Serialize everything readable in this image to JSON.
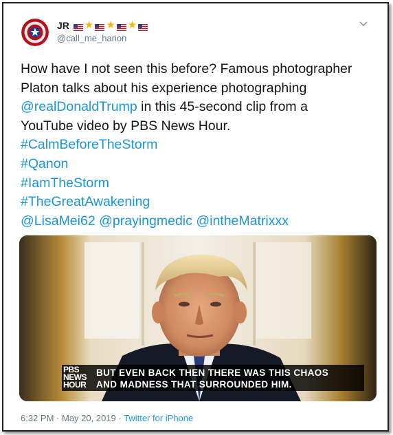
{
  "user": {
    "display_name": "JR",
    "handle": "@call_me_hanon",
    "name_emoji": [
      "us-flag-icon",
      "star-icon",
      "us-flag-icon",
      "star-icon",
      "us-flag-icon",
      "star-icon",
      "us-flag-icon"
    ],
    "avatar_icon": "captain-america-shield-icon"
  },
  "tweet": {
    "line1": "How have I not seen this before? Famous photographer",
    "line2": "Platon talks about his experience photographing",
    "mention_trump": "@realDonaldTrump",
    "line3_rest": " in this 45-second clip from a",
    "line4": "YouTube video by PBS News Hour.",
    "hashtags": [
      "#CalmBeforeTheStorm",
      "#Qanon",
      "#IamTheStorm",
      "#TheGreatAwakening"
    ],
    "mentions": [
      "@LisaMei62",
      "@prayingmedic",
      "@intheMatrixxx"
    ]
  },
  "media": {
    "network_logo": [
      "PBS",
      "NEWS",
      "HOUR"
    ],
    "caption_line1": "BUT EVEN BACK THEN THERE WAS THIS CHAOS",
    "caption_line2": "AND MADNESS THAT SURROUNDED HIM."
  },
  "footer": {
    "time": "6:32 PM",
    "separator": " · ",
    "date": "May 20, 2019",
    "source": "Twitter for iPhone"
  },
  "colors": {
    "link": "#1b95e0",
    "text": "#14171a",
    "muted": "#657786",
    "star": "#f5b800"
  }
}
